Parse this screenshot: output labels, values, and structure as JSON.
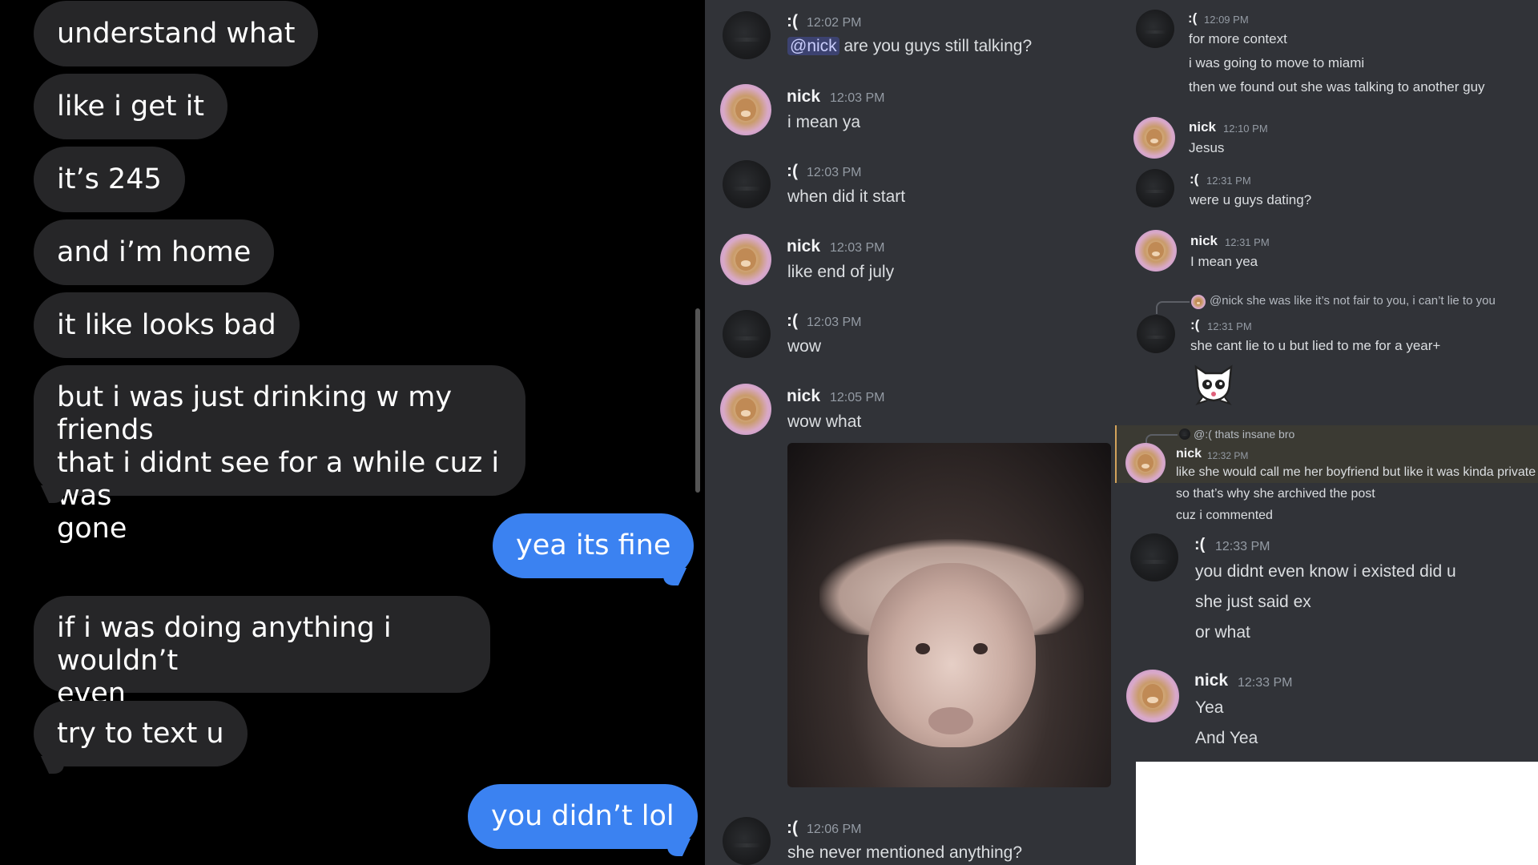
{
  "imessage": {
    "messages": [
      {
        "side": "in",
        "text": "understand what"
      },
      {
        "side": "in",
        "text": "like i get it"
      },
      {
        "side": "in",
        "text": "it’s 245"
      },
      {
        "side": "in",
        "text": "and i’m home"
      },
      {
        "side": "in",
        "text": "it like looks bad"
      },
      {
        "side": "in",
        "lines": [
          "but i was just drinking w my friends",
          "that i didnt see for a while cuz i was",
          "gone"
        ]
      },
      {
        "side": "out",
        "text": "yea its fine"
      },
      {
        "side": "in",
        "lines": [
          "if i was doing anything i wouldn’t",
          "even"
        ]
      },
      {
        "side": "in",
        "text": "try to text u"
      },
      {
        "side": "out",
        "text": "you didn’t lol"
      }
    ]
  },
  "discord_left": {
    "messages": [
      {
        "author": ":(",
        "time": "12:02 PM",
        "mention": "@nick",
        "text": " are you guys still talking?"
      },
      {
        "author": "nick",
        "time": "12:03 PM",
        "text": "i mean ya"
      },
      {
        "author": ":(",
        "time": "12:03 PM",
        "text": "when did it start"
      },
      {
        "author": "nick",
        "time": "12:03 PM",
        "text": "like end of july"
      },
      {
        "author": ":(",
        "time": "12:03 PM",
        "text": "wow"
      },
      {
        "author": "nick",
        "time": "12:05 PM",
        "text": "wow what"
      },
      {
        "author": ":(",
        "time": "12:06 PM",
        "text": "she never mentioned anything?"
      }
    ]
  },
  "discord_right": {
    "m1": {
      "author": ":(",
      "time": "12:09 PM",
      "lines": [
        "for more context",
        "i was going to move to miami",
        "then we found out she was talking to another guy"
      ]
    },
    "m2": {
      "author": "nick",
      "time": "12:10 PM",
      "text": "Jesus"
    },
    "m3": {
      "author": ":(",
      "time": "12:31 PM",
      "text": "were u guys dating?"
    },
    "m4": {
      "author": "nick",
      "time": "12:31 PM",
      "text": "I mean yea"
    },
    "m5": {
      "reply_mention": "@nick",
      "reply_text": "she was like it’s not fair to you, i can’t lie to you",
      "author": ":(",
      "time": "12:31 PM",
      "text": "she cant lie to u but lied to me for a year+"
    },
    "m6": {
      "reply_mention": "@:(",
      "reply_text": "thats insane bro",
      "author": "nick",
      "time": "12:32 PM",
      "lines": [
        "like she would call me her boyfriend but like it was kinda private",
        "so that’s why she archived the post",
        "cuz i commented"
      ]
    },
    "m7": {
      "author": ":(",
      "time": "12:33 PM",
      "lines": [
        "you didnt even know i existed did u",
        "she just said ex",
        "or what"
      ]
    },
    "m8": {
      "author": "nick",
      "time": "12:33 PM",
      "lines": [
        "Yea",
        "And Yea"
      ]
    }
  },
  "colors": {
    "imessage_in": "#262628",
    "imessage_out": "#3b82f1",
    "discord_bg": "#313338",
    "mention_bg": "#3c4270",
    "highlight_bar": "#d3a35b"
  }
}
